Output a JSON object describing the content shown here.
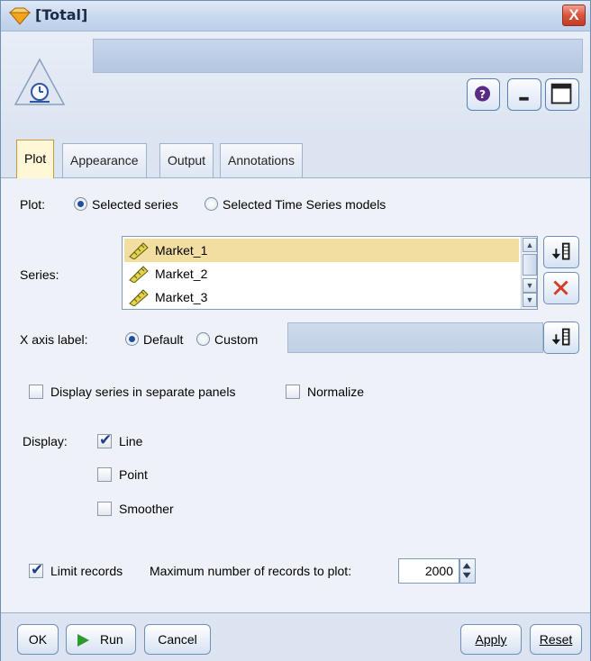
{
  "window": {
    "title": "[Total]",
    "close_symbol": "X"
  },
  "header": {
    "node_name": ""
  },
  "tabs": [
    {
      "label": "Plot",
      "active": true
    },
    {
      "label": "Appearance",
      "active": false
    },
    {
      "label": "Output",
      "active": false
    },
    {
      "label": "Annotations",
      "active": false
    }
  ],
  "plot": {
    "label": "Plot:",
    "option_series": "Selected series",
    "option_models": "Selected Time Series models",
    "selected_option": "Selected series"
  },
  "series": {
    "label": "Series:",
    "items": [
      "Market_1",
      "Market_2",
      "Market_3"
    ],
    "selected": "Market_1"
  },
  "x_axis": {
    "label": "X axis label:",
    "option_default": "Default",
    "option_custom": "Custom",
    "selected_option": "Default",
    "custom_value": ""
  },
  "options": {
    "separate_panels": {
      "label": "Display series in separate panels",
      "checked": false
    },
    "normalize": {
      "label": "Normalize",
      "checked": false
    }
  },
  "display": {
    "label": "Display:",
    "line": {
      "label": "Line",
      "checked": true
    },
    "point": {
      "label": "Point",
      "checked": false
    },
    "smoother": {
      "label": "Smoother",
      "checked": false
    }
  },
  "limit": {
    "label": "Limit records",
    "checked": true,
    "max_label": "Maximum number of records to plot:",
    "max_value": "2000"
  },
  "footer": {
    "ok": "OK",
    "run": "Run",
    "cancel": "Cancel",
    "apply": "Apply",
    "reset": "Reset"
  },
  "colors": {
    "selection": "#f3dea1",
    "active_tab": "#fff7d6",
    "run_arrow": "#2c9a2c",
    "delete_x": "#d63a24"
  }
}
